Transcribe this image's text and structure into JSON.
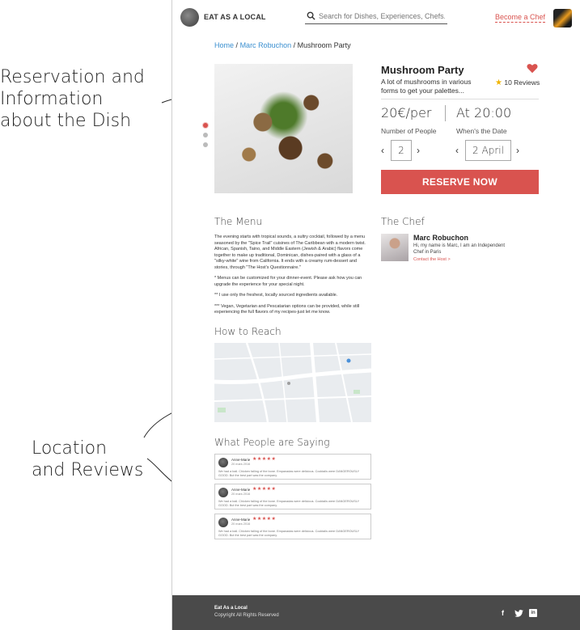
{
  "annotations": {
    "info_line1": "Reservation and",
    "info_line2": "Information",
    "info_line3": "about the Dish",
    "location_line1": "Location",
    "location_line2": "and Reviews"
  },
  "header": {
    "brand": "EAT AS A LOCAL",
    "search_placeholder": "Search for Dishes, Experiences, Chefs...",
    "become_chef": "Become a Chef"
  },
  "breadcrumb": {
    "home": "Home",
    "chef": "Marc Robuchon",
    "current": "Mushroom Party",
    "separator": "/"
  },
  "carousel": {
    "slides": 3,
    "active_index": 0
  },
  "dish": {
    "title": "Mushroom Party",
    "description": "A lot of mushrooms in various forms to get your palettes...",
    "reviews_label": "10 Reviews",
    "price": "20€/per",
    "time": "At 20:00",
    "people_label": "Number of People",
    "people_value": "2",
    "date_label": "When's the Date",
    "date_value": "2 April",
    "reserve_label": "RESERVE NOW",
    "favorite_color": "#d9534f"
  },
  "menu": {
    "heading": "The Menu",
    "paragraphs": [
      "The evening starts with tropical sounds, a sultry cocktail, followed by a menu seasoned by the \"Spice Trail\" cuisines of The Caribbean with a modern twist. African, Spanish, Taino, and Middle Eastern (Jewish & Arabic) flavors come together to make up traditional, Dominican, dishes-paired with a glass of a \"silky-white\" wine from California. It ends with a creamy rum-dessert and stories, through \"The Host's Questionnaire.\"",
      "* Menus can be customized for your dinner-event. Please ask how you can upgrade the experience for your special night.",
      "** I use only the freshest, locally sourced ingredients available.",
      "*** Vegan, Vegetarian and Pescatarian options can be provided, while still experiencing the full flavors of my recipes-just let me know."
    ]
  },
  "chef": {
    "heading": "The Chef",
    "name": "Marc Robuchon",
    "bio": "Hi, my name is Marc, I am an Independent Chef in Paris",
    "contact": "Contact the Host >"
  },
  "reach": {
    "heading": "How to Reach"
  },
  "testimonials": {
    "heading": "What People are Saying",
    "items": [
      {
        "name": "Anne-Marie",
        "date": "20 mars 2016",
        "stars": "★★★★★",
        "text": "We had a ball. Chicken falling of the bone. Empanadas were delicious. Cocktails were DANGEROUSLY GOOD. But the best part was the company."
      },
      {
        "name": "Anne-Marie",
        "date": "20 mars 2016",
        "stars": "★★★★★",
        "text": "We had a ball. Chicken falling of the bone. Empanadas were delicious. Cocktails were DANGEROUSLY GOOD. But the best part was the company."
      },
      {
        "name": "Anne-Marie",
        "date": "20 mars 2016",
        "stars": "★★★★★",
        "text": "We had a ball. Chicken falling of the bone. Empanadas were delicious. Cocktails were DANGEROUSLY GOOD. But the best part was the company."
      }
    ]
  },
  "footer": {
    "brand": "Eat As a Local",
    "copyright": "Copyright All Rights Reserved",
    "social": {
      "facebook": "f",
      "twitter": "🐦",
      "linkedin": "in"
    }
  },
  "colors": {
    "accent": "#d9534f",
    "link": "#3a8fd0",
    "footer_bg": "#4a4a4a",
    "star": "#f0b400"
  }
}
